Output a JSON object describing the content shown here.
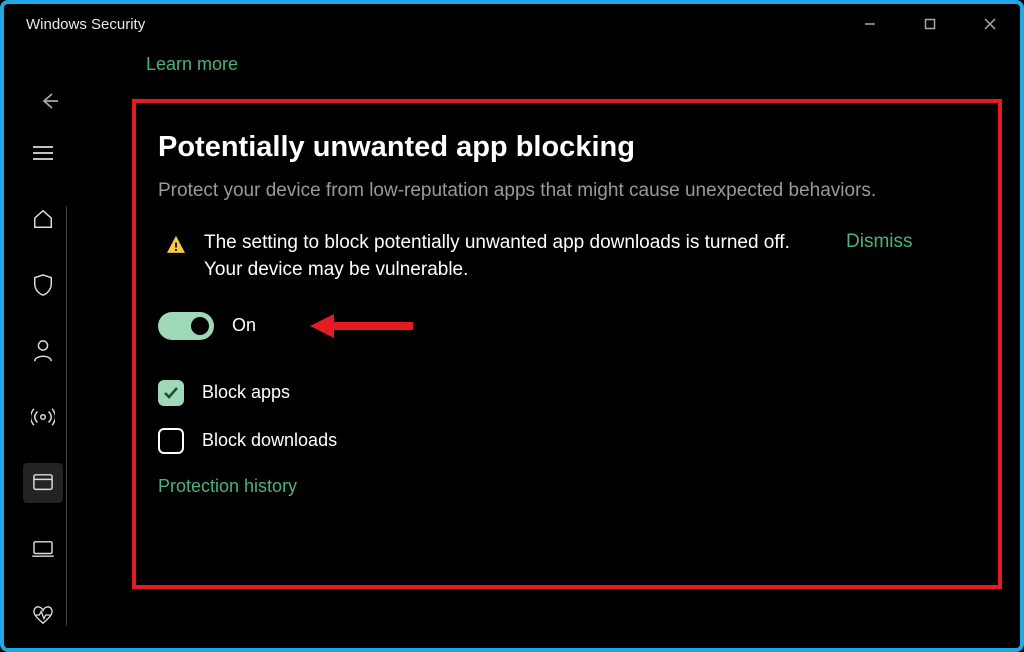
{
  "window": {
    "title": "Windows Security"
  },
  "top": {
    "learn_more": "Learn more"
  },
  "section": {
    "heading": "Potentially unwanted app blocking",
    "description": "Protect your device from low-reputation apps that might cause unexpected behaviors."
  },
  "warning": {
    "text": "The setting to block potentially unwanted app downloads is turned off. Your device may be vulnerable.",
    "dismiss": "Dismiss"
  },
  "toggle": {
    "state_label": "On",
    "value": true
  },
  "checkboxes": {
    "block_apps": {
      "label": "Block apps",
      "checked": true
    },
    "block_downloads": {
      "label": "Block downloads",
      "checked": false
    }
  },
  "footer": {
    "protection_history": "Protection history"
  },
  "annotation": {
    "highlight_color": "#e31b23",
    "arrow_target": "toggle-on"
  }
}
